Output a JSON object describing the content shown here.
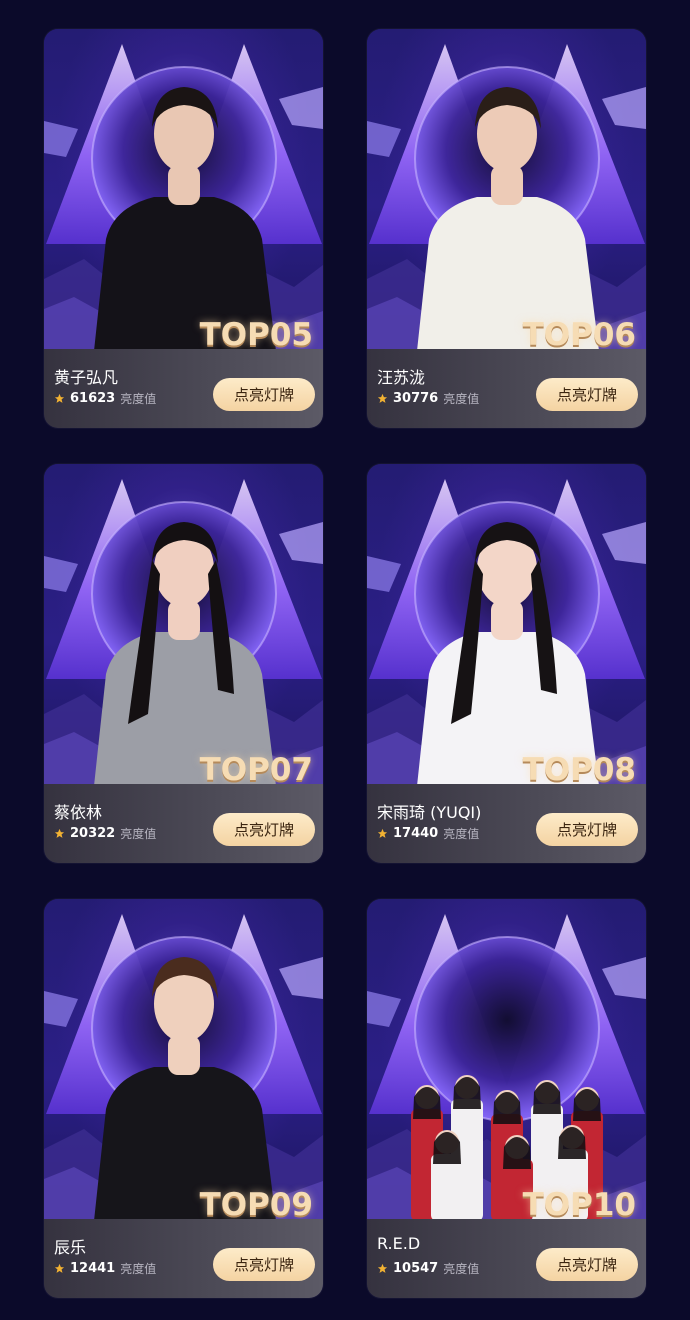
{
  "cards": [
    {
      "rank": "TOP05",
      "name": "黄子弘凡",
      "score": "61623",
      "unit": "亮度值",
      "button": "点亮灯牌",
      "outfit": "#141218",
      "skin": "#e9c7b3",
      "hair": "#1a1414"
    },
    {
      "rank": "TOP06",
      "name": "汪苏泷",
      "score": "30776",
      "unit": "亮度值",
      "button": "点亮灯牌",
      "outfit": "#f1efe9",
      "skin": "#edcbb7",
      "hair": "#2a1e18"
    },
    {
      "rank": "TOP07",
      "name": "蔡依林",
      "score": "20322",
      "unit": "亮度值",
      "button": "点亮灯牌",
      "outfit": "#9c9ea6",
      "skin": "#f0cfc0",
      "hair": "#141012"
    },
    {
      "rank": "TOP08",
      "name": "宋雨琦 (YUQI)",
      "score": "17440",
      "unit": "亮度值",
      "button": "点亮灯牌",
      "outfit": "#f4f3f6",
      "skin": "#f3d6c8",
      "hair": "#161214"
    },
    {
      "rank": "TOP09",
      "name": "辰乐",
      "score": "12441",
      "unit": "亮度值",
      "button": "点亮灯牌",
      "outfit": "#16151a",
      "skin": "#efd0bd",
      "hair": "#4a2c1e"
    },
    {
      "rank": "TOP10",
      "name": "R.E.D",
      "score": "10547",
      "unit": "亮度值",
      "button": "点亮灯牌",
      "outfit": "#c22633",
      "skin": "#f0d2c2",
      "hair": "#151012"
    }
  ],
  "colors": {
    "page_bg": "#0b0a2a",
    "button_bg": "#f8ddb0",
    "star": "#f2b233",
    "rank_text": "#f6dcb4"
  },
  "icons": {
    "star": "star-icon"
  }
}
